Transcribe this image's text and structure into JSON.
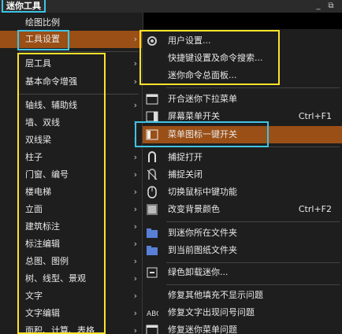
{
  "window": {
    "title": "迷你工具"
  },
  "left_menu": {
    "items": [
      {
        "label": "绘图比例",
        "arrow": ""
      },
      {
        "label": "工具设置",
        "arrow": "›"
      },
      {
        "label": "层工具",
        "arrow": "›"
      },
      {
        "label": "基本命令增强",
        "arrow": "›"
      },
      {
        "label": "轴线、辅助线",
        "arrow": "›"
      },
      {
        "label": "墙、双线",
        "arrow": "›"
      },
      {
        "label": "双线梁",
        "arrow": "›"
      },
      {
        "label": "柱子",
        "arrow": "›"
      },
      {
        "label": "门窗、编号",
        "arrow": "›"
      },
      {
        "label": "楼电梯",
        "arrow": "›"
      },
      {
        "label": "立面",
        "arrow": "›"
      },
      {
        "label": "建筑标注",
        "arrow": "›"
      },
      {
        "label": "标注编辑",
        "arrow": "›"
      },
      {
        "label": "总图、图例",
        "arrow": "›"
      },
      {
        "label": "树、线型、景观",
        "arrow": "›"
      },
      {
        "label": "文字",
        "arrow": "›"
      },
      {
        "label": "文字编辑",
        "arrow": "›"
      },
      {
        "label": "面积、计算、表格",
        "arrow": "›"
      }
    ]
  },
  "sub_menu": {
    "items": [
      {
        "label": "用户设置...",
        "shortcut": ""
      },
      {
        "label": "快捷键设置及命令搜索...",
        "shortcut": ""
      },
      {
        "label": "迷你命令总面板...",
        "shortcut": ""
      },
      {
        "label": "开合迷你下拉菜单",
        "shortcut": ""
      },
      {
        "label": "屏幕菜单开关",
        "shortcut": "Ctrl+F1"
      },
      {
        "label": "菜单图标一键开关",
        "shortcut": ""
      },
      {
        "label": "捕捉打开",
        "shortcut": ""
      },
      {
        "label": "捕捉关闭",
        "shortcut": ""
      },
      {
        "label": "切换鼠标中键功能",
        "shortcut": ""
      },
      {
        "label": "改变背景颜色",
        "shortcut": "Ctrl+F2"
      },
      {
        "label": "到迷你所在文件夹",
        "shortcut": ""
      },
      {
        "label": "到当前图纸文件夹",
        "shortcut": ""
      },
      {
        "label": "绿色卸载迷你...",
        "shortcut": ""
      },
      {
        "label": "修复其他填充不显示问题",
        "shortcut": ""
      },
      {
        "label": "修复文字出现问号问题",
        "shortcut": ""
      },
      {
        "label": "修复迷你菜单问题",
        "shortcut": ""
      }
    ]
  },
  "colors": {
    "highlight": "#9a4f16",
    "yellow_box": "#ffe22a",
    "cyan_box": "#3fc3e3"
  }
}
